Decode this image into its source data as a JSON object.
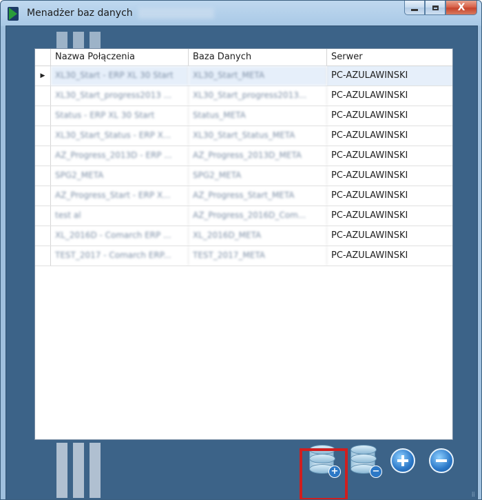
{
  "window": {
    "title": "Menadżer baz danych",
    "title_suffix_obscured": "",
    "controls": {
      "minimize": "minimize",
      "maximize": "maximize",
      "close": "X"
    }
  },
  "grid": {
    "columns": [
      "Nazwa Połączenia",
      "Baza Danych",
      "Serwer"
    ],
    "selected_row_marker": "▶",
    "rows": [
      {
        "name": "XL30_Start - ERP XL 30 Start",
        "database": "XL30_Start_META",
        "server": "PC-AZULAWINSKI"
      },
      {
        "name": "XL30_Start_progress2013 ...",
        "database": "XL30_Start_progress2013...",
        "server": "PC-AZULAWINSKI"
      },
      {
        "name": "Status - ERP XL 30 Start",
        "database": "Status_META",
        "server": "PC-AZULAWINSKI"
      },
      {
        "name": "XL30_Start_Status - ERP X...",
        "database": "XL30_Start_Status_META",
        "server": "PC-AZULAWINSKI"
      },
      {
        "name": "AZ_Progress_2013D - ERP ...",
        "database": "AZ_Progress_2013D_META",
        "server": "PC-AZULAWINSKI"
      },
      {
        "name": "SPG2_META",
        "database": "SPG2_META",
        "server": "PC-AZULAWINSKI"
      },
      {
        "name": "AZ_Progress_Start - ERP X...",
        "database": "AZ_Progress_Start_META",
        "server": "PC-AZULAWINSKI"
      },
      {
        "name": "test al",
        "database": "AZ_Progress_2016D_Com...",
        "server": "PC-AZULAWINSKI"
      },
      {
        "name": "XL_2016D - Comarch ERP ...",
        "database": "XL_2016D_META",
        "server": "PC-AZULAWINSKI"
      },
      {
        "name": "TEST_2017 - Comarch ERP...",
        "database": "TEST_2017_META",
        "server": "PC-AZULAWINSKI"
      }
    ]
  },
  "toolbar": {
    "icons": {
      "add_database": "database-add-icon",
      "remove_database": "database-remove-icon",
      "add": "plus-circle-icon",
      "remove": "minus-circle-icon"
    },
    "badge_plus": "+",
    "badge_minus": "−"
  },
  "colors": {
    "window_frame": "#a9c9e6",
    "client_bg": "#3c6388",
    "selected_row": "#e6effa",
    "highlight": "#d01e1e",
    "accent_blue": "#2b78c8"
  }
}
